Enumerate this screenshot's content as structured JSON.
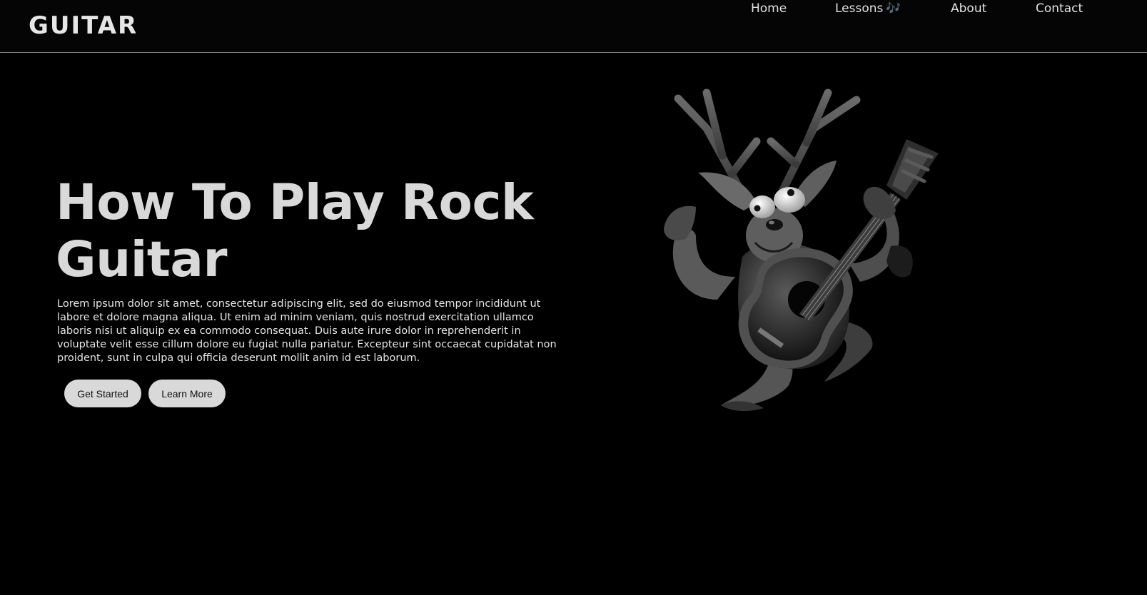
{
  "header": {
    "logo": "GUITAR",
    "nav": [
      {
        "label": "Home"
      },
      {
        "label": "Lessons",
        "icon": "music-notes-icon",
        "icon_glyph": "🎶"
      },
      {
        "label": "About"
      },
      {
        "label": "Contact"
      }
    ]
  },
  "hero": {
    "title": "How To Play Rock Guitar",
    "body": "Lorem ipsum dolor sit amet, consectetur adipiscing elit, sed do eiusmod tempor incididunt ut labore et dolore magna aliqua. Ut enim ad minim veniam, quis nostrud exercitation ullamco laboris nisi ut aliquip ex ea commodo consequat. Duis aute irure dolor in reprehenderit in voluptate velit esse cillum dolore eu fugiat nulla pariatur. Excepteur sint occaecat cupidatat non proident, sunt in culpa qui officia deserunt mollit anim id est laborum.",
    "buttons": {
      "get_started": "Get Started",
      "learn_more": "Learn More"
    },
    "illustration": "reindeer-playing-guitar"
  },
  "colors": {
    "background": "#000000",
    "text": "#d9d9d9",
    "button_bg": "#d9d9d9",
    "nav_border": "#8a8a8a"
  }
}
